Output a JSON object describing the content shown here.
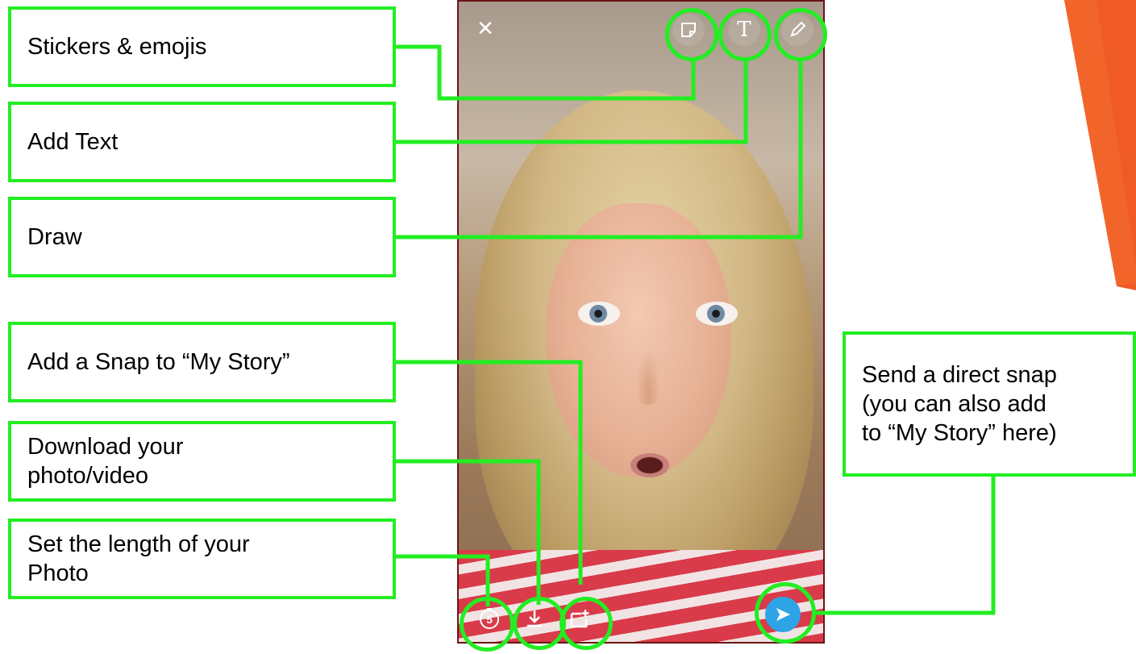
{
  "callouts": {
    "stickers": "Stickers & emojis",
    "add_text": "Add Text",
    "draw": "Draw",
    "add_story": "Add a Snap to “My Story”",
    "download": "Download your\nphoto/video",
    "length": "Set the length of your\nPhoto",
    "send": "Send a direct snap\n(you can also add\nto “My Story” here)"
  },
  "phone": {
    "close_icon": "close-icon",
    "sticker_icon": "sticker-icon",
    "text_icon": "text-icon",
    "text_glyph": "T",
    "pencil_icon": "pencil-icon",
    "timer_icon": "timer-icon",
    "timer_value": "5",
    "download_icon": "download-icon",
    "story_icon": "add-story-icon",
    "send_icon": "send-icon"
  },
  "colors": {
    "callout_border": "#22ee22",
    "send_button": "#2ea3e6",
    "accent": "#ef5a26"
  }
}
